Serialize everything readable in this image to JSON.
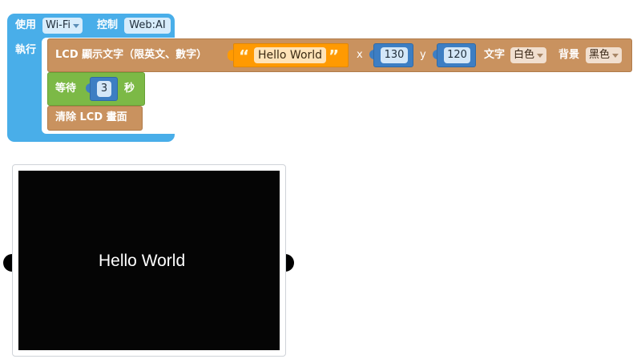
{
  "blocks": {
    "use_label": "使用",
    "connection_type": "Wi-Fi",
    "control_label": "控制",
    "device_name": "Web:AI",
    "exec_label": "執行",
    "lcd_label": "LCD 顯示文字（限英文、數字）",
    "text_value": "Hello World",
    "x_label": "x",
    "x_value": "130",
    "y_label": "y",
    "y_value": "120",
    "text_color_label": "文字",
    "text_color": "白色",
    "bg_label": "背景",
    "bg_color": "黑色",
    "wait_label": "等待",
    "wait_value": "3",
    "seconds_label": "秒",
    "clear_label": "清除 LCD 畫面"
  },
  "lcd": {
    "display_text": "Hello World",
    "screen_color": "#050505",
    "text_color": "#ffffff"
  },
  "colors": {
    "use_block": "#49aee9",
    "lcd_block": "#c9925f",
    "wait_block": "#7cb946",
    "string_block": "#ff9a02",
    "number_block": "#3d7ec3"
  }
}
